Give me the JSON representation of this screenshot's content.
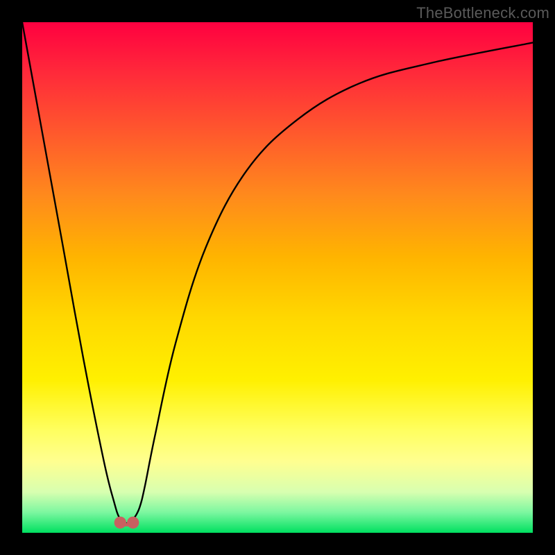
{
  "watermark": "TheBottleneck.com",
  "chart_data": {
    "type": "line",
    "title": "",
    "xlabel": "",
    "ylabel": "",
    "xlim": [
      0,
      100
    ],
    "ylim": [
      0,
      100
    ],
    "grid": false,
    "legend": false,
    "series": [
      {
        "name": "curve",
        "x": [
          0,
          4,
          8,
          12,
          16,
          18,
          19,
          20,
          21,
          22,
          23,
          24,
          26,
          30,
          36,
          44,
          54,
          66,
          80,
          100
        ],
        "y": [
          100,
          78,
          56,
          34,
          14,
          6,
          3,
          2,
          2,
          3,
          5,
          9,
          19,
          37,
          56,
          71,
          81,
          88,
          92,
          96
        ]
      }
    ],
    "markers": [
      {
        "name": "left-min-marker",
        "x": 19.2,
        "y": 2.0,
        "r": 1.0,
        "color": "#c86060"
      },
      {
        "name": "right-min-marker",
        "x": 21.7,
        "y": 2.0,
        "r": 1.0,
        "color": "#c86060"
      }
    ],
    "marker_connector": {
      "stroke": "#c86060",
      "width": 5
    }
  }
}
